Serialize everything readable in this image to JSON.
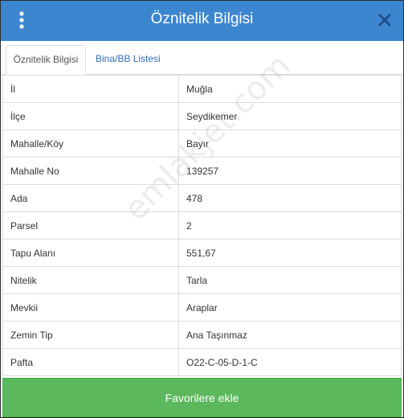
{
  "header": {
    "title": "Öznitelik Bilgisi",
    "menu_icon": "vertical-dots-icon",
    "close_icon": "close-icon"
  },
  "tabs": [
    {
      "label": "Öznitelik Bilgisi",
      "active": true
    },
    {
      "label": "Bina/BB Listesi",
      "active": false
    }
  ],
  "rows": [
    {
      "label": "İl",
      "value": "Muğla"
    },
    {
      "label": "İlçe",
      "value": "Seydikemer"
    },
    {
      "label": "Mahalle/Köy",
      "value": "Bayır"
    },
    {
      "label": "Mahalle No",
      "value": "139257"
    },
    {
      "label": "Ada",
      "value": "478"
    },
    {
      "label": "Parsel",
      "value": "2"
    },
    {
      "label": "Tapu Alanı",
      "value": "551,67"
    },
    {
      "label": "Nitelik",
      "value": "Tarla"
    },
    {
      "label": "Mevkii",
      "value": "Araplar"
    },
    {
      "label": "Zemin Tip",
      "value": "Ana Taşınmaz"
    },
    {
      "label": "Pafta",
      "value": "O22-C-05-D-1-C"
    }
  ],
  "watermark": "emlakjet.com",
  "footer": {
    "favorite_label": "Favorilere ekle"
  },
  "colors": {
    "header": "#3c86cf",
    "favorite_button": "#5cb85c",
    "tab_link": "#2f6eb5"
  }
}
